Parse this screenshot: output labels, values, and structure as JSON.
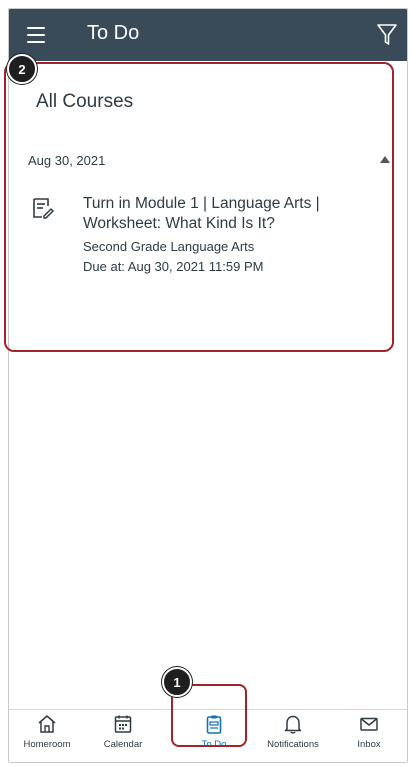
{
  "header": {
    "title": "To Do"
  },
  "section": {
    "title": "All Courses"
  },
  "date_group": {
    "label": "Aug 30, 2021"
  },
  "assignment": {
    "title": "Turn in Module 1 | Language Arts | Worksheet: What Kind Is It?",
    "course": "Second Grade Language Arts",
    "due": "Due at: Aug 30, 2021 11:59 PM"
  },
  "callouts": {
    "one": "1",
    "two": "2"
  },
  "tabs": [
    {
      "label": "Homeroom",
      "icon": "home-icon"
    },
    {
      "label": "Calendar",
      "icon": "calendar-icon"
    },
    {
      "label": "To Do",
      "icon": "clipboard-icon",
      "active": true
    },
    {
      "label": "Notifications",
      "icon": "bell-icon"
    },
    {
      "label": "Inbox",
      "icon": "mail-icon"
    }
  ],
  "colors": {
    "header_bg": "#394b58",
    "highlight": "#a3232b",
    "active_tab": "#1273b4"
  }
}
